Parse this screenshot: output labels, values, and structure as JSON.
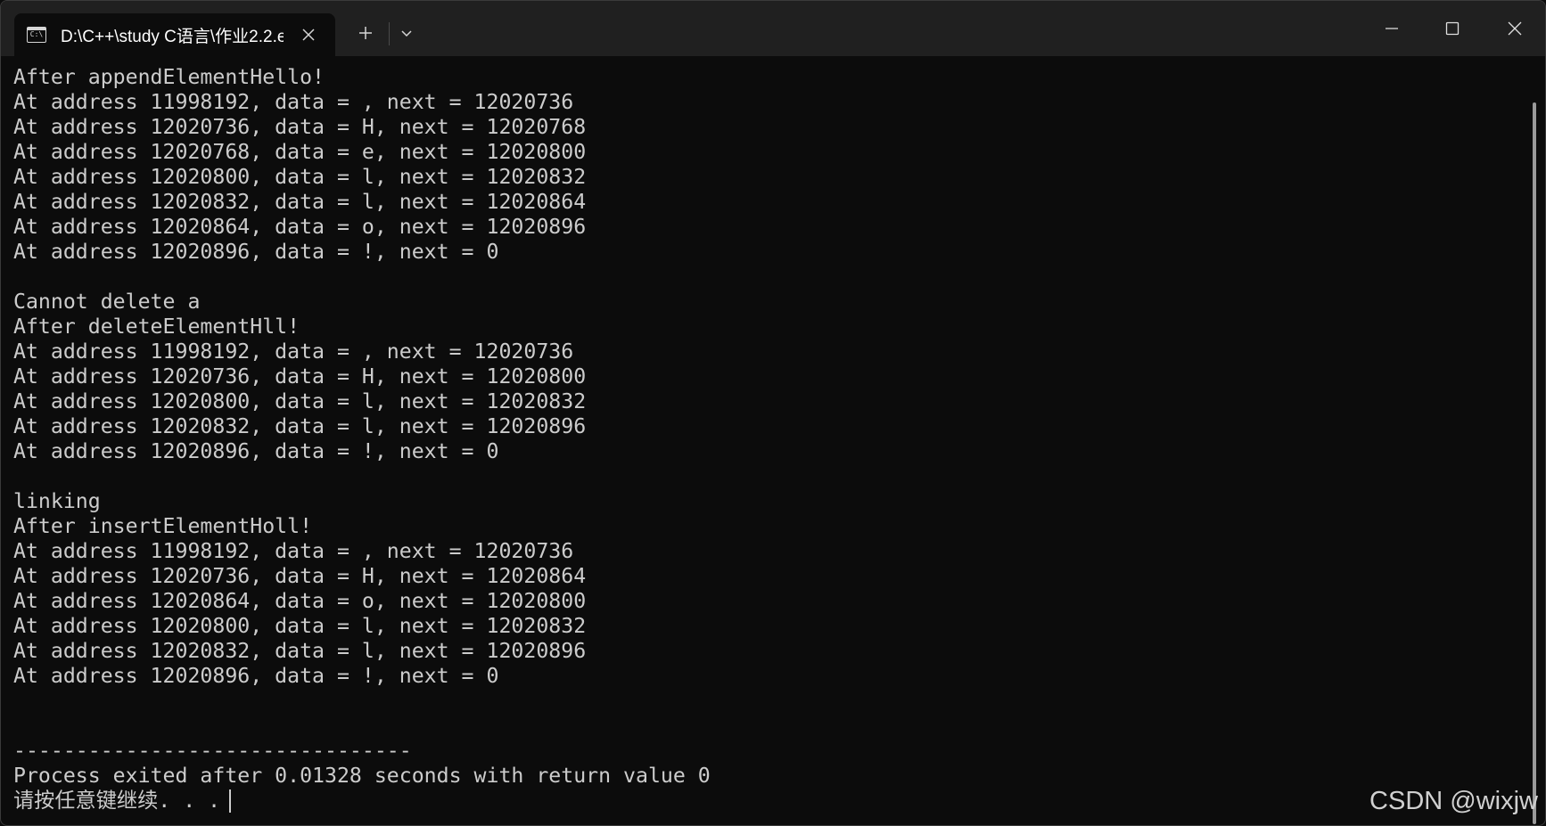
{
  "tab": {
    "title": "D:\\C++\\study C语言\\作业2.2.e",
    "icon": "console-icon"
  },
  "icons": {
    "close_tab": "close-icon",
    "new_tab": "plus-icon",
    "dropdown": "chevron-down-icon",
    "minimize": "minimize-icon",
    "maximize": "maximize-icon",
    "close_window": "close-icon"
  },
  "colors": {
    "console_bg": "#0c0c0c",
    "console_text": "#cccccc",
    "titlebar_bg": "#202020"
  },
  "console": {
    "lines": [
      "After appendElementHello!",
      "At address 11998192, data = , next = 12020736",
      "At address 12020736, data = H, next = 12020768",
      "At address 12020768, data = e, next = 12020800",
      "At address 12020800, data = l, next = 12020832",
      "At address 12020832, data = l, next = 12020864",
      "At address 12020864, data = o, next = 12020896",
      "At address 12020896, data = !, next = 0",
      "",
      "Cannot delete a",
      "After deleteElementHll!",
      "At address 11998192, data = , next = 12020736",
      "At address 12020736, data = H, next = 12020800",
      "At address 12020800, data = l, next = 12020832",
      "At address 12020832, data = l, next = 12020896",
      "At address 12020896, data = !, next = 0",
      "",
      "linking",
      "After insertElementHoll!",
      "At address 11998192, data = , next = 12020736",
      "At address 12020736, data = H, next = 12020864",
      "At address 12020864, data = o, next = 12020800",
      "At address 12020800, data = l, next = 12020832",
      "At address 12020832, data = l, next = 12020896",
      "At address 12020896, data = !, next = 0",
      "",
      "",
      "--------------------------------",
      "Process exited after 0.01328 seconds with return value 0"
    ],
    "prompt": "请按任意键继续. . ."
  },
  "watermark": "CSDN @wixjw"
}
